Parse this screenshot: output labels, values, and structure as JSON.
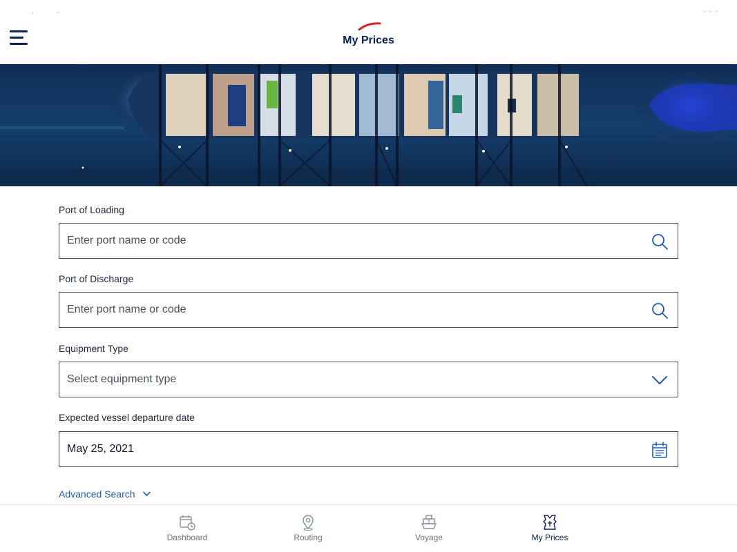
{
  "header": {
    "title": "My Prices",
    "menu_icon": "hamburger-menu-icon",
    "brand_color": "#d6202a"
  },
  "form": {
    "port_of_loading": {
      "label": "Port of Loading",
      "placeholder": "Enter port name or code",
      "icon": "search-icon"
    },
    "port_of_discharge": {
      "label": "Port of Discharge",
      "placeholder": "Enter port name or code",
      "icon": "search-icon"
    },
    "equipment_type": {
      "label": "Equipment Type",
      "placeholder": "Select equipment type",
      "icon": "chevron-down-icon"
    },
    "departure_date": {
      "label": "Expected vessel departure date",
      "value": "May 25, 2021",
      "icon": "calendar-icon"
    },
    "advanced_search": "Advanced Search"
  },
  "tabs": [
    {
      "label": "Dashboard",
      "icon": "calendar-clock-icon",
      "active": false
    },
    {
      "label": "Routing",
      "icon": "map-pin-icon",
      "active": false
    },
    {
      "label": "Voyage",
      "icon": "ship-icon",
      "active": false
    },
    {
      "label": "My Prices",
      "icon": "price-tag-icon",
      "active": true
    }
  ],
  "colors": {
    "accent": "#1e5bbd",
    "navy": "#0b1f52",
    "border": "#3f4657"
  }
}
